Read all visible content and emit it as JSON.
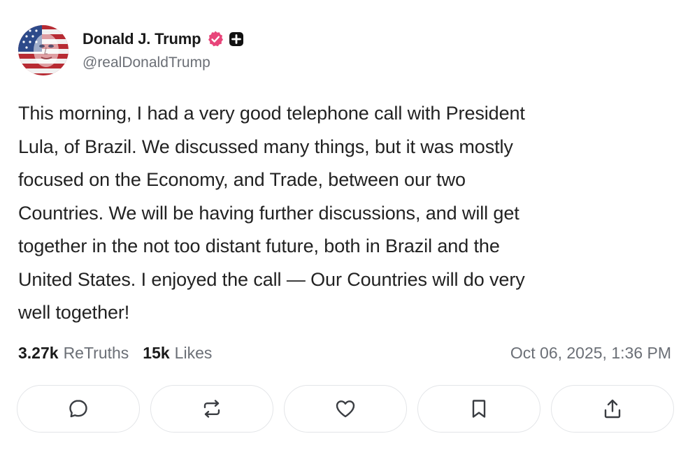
{
  "author": {
    "display_name": "Donald J. Trump",
    "handle": "@realDonaldTrump",
    "avatar_icon": "avatar-american-flag-portrait",
    "verified_icon": "verified-badge-icon",
    "verified_color": "#e8457a",
    "badge_icon": "plus-badge-icon"
  },
  "post": {
    "text": "This morning, I had a very good telephone call with President\nLula, of Brazil. We discussed many things, but it was mostly\nfocused on the Economy, and Trade, between our two\nCountries. We will be having further discussions, and will get\ntogether in the not too distant future, both in Brazil and the\nUnited States. I enjoyed the call — Our Countries will do very\nwell together!"
  },
  "stats": {
    "retruths_count": "3.27k",
    "retruths_label": "ReTruths",
    "likes_count": "15k",
    "likes_label": "Likes",
    "timestamp": "Oct 06, 2025, 1:36 PM"
  },
  "actions": [
    {
      "name": "reply",
      "icon": "comment-icon"
    },
    {
      "name": "retruth",
      "icon": "repost-icon"
    },
    {
      "name": "like",
      "icon": "heart-icon"
    },
    {
      "name": "bookmark",
      "icon": "bookmark-icon"
    },
    {
      "name": "share",
      "icon": "share-icon"
    }
  ],
  "colors": {
    "text_primary": "#1a1a1a",
    "text_secondary": "#6b6f76",
    "button_border": "#e3e5e8",
    "icon": "#3a3d42"
  }
}
